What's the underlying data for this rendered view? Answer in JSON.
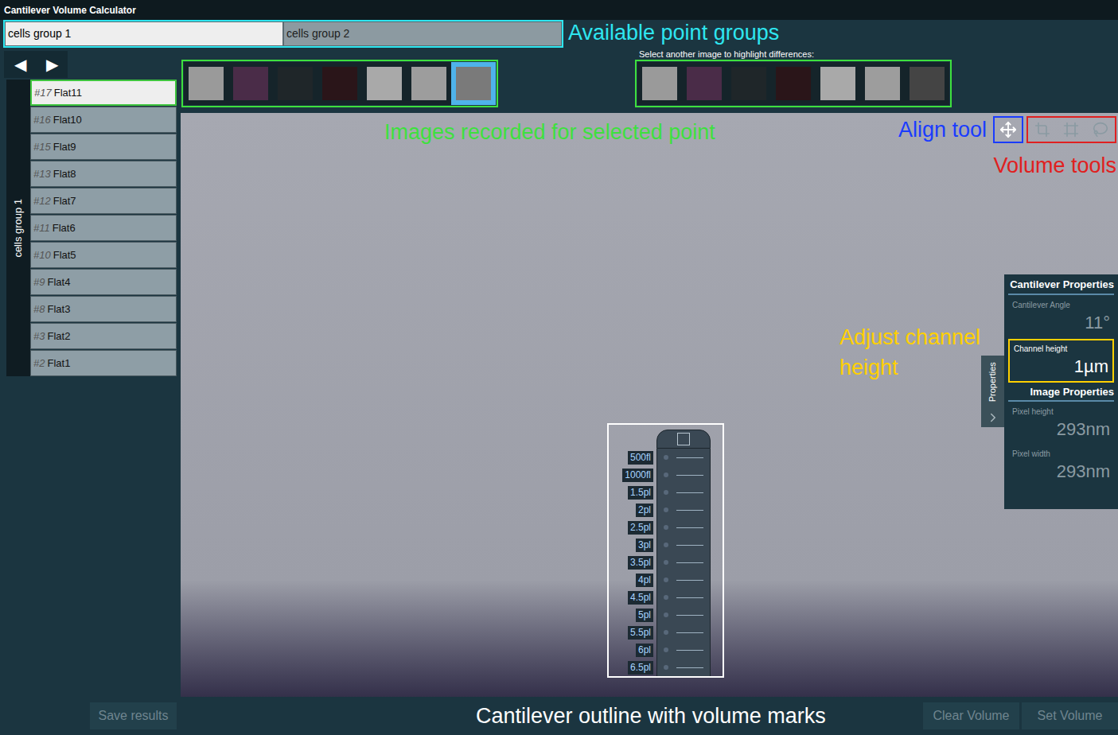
{
  "window": {
    "title": "Cantilever Volume Calculator"
  },
  "point_groups": {
    "annotation": "Available point groups",
    "tabs": [
      {
        "label": "cells group 1",
        "selected": true
      },
      {
        "label": "cells group 2",
        "selected": false
      }
    ]
  },
  "navigation": {
    "prev": "◀",
    "next": "▶"
  },
  "sidebar": {
    "group_label": "cells group 1",
    "items": [
      {
        "id": "#17",
        "name": "Flat11",
        "selected": true
      },
      {
        "id": "#16",
        "name": "Flat10",
        "selected": false
      },
      {
        "id": "#15",
        "name": "Flat9",
        "selected": false
      },
      {
        "id": "#13",
        "name": "Flat8",
        "selected": false
      },
      {
        "id": "#12",
        "name": "Flat7",
        "selected": false
      },
      {
        "id": "#11",
        "name": "Flat6",
        "selected": false
      },
      {
        "id": "#10",
        "name": "Flat5",
        "selected": false
      },
      {
        "id": "#9",
        "name": "Flat4",
        "selected": false
      },
      {
        "id": "#8",
        "name": "Flat3",
        "selected": false
      },
      {
        "id": "#3",
        "name": "Flat2",
        "selected": false
      },
      {
        "id": "#2",
        "name": "Flat1",
        "selected": false
      }
    ]
  },
  "images": {
    "annotation": "Images recorded for selected point",
    "thumbnails": [
      {
        "color": "#9a9a9a",
        "selected": false
      },
      {
        "color": "#4a2c48",
        "selected": false
      },
      {
        "color": "#1f2629",
        "selected": false
      },
      {
        "color": "#2a1519",
        "selected": false
      },
      {
        "color": "#a9a9a9",
        "selected": false
      },
      {
        "color": "#9d9d9d",
        "selected": false
      },
      {
        "color": "#7a7a7a",
        "selected": true
      }
    ]
  },
  "compare": {
    "label": "Select another image to highlight differences:",
    "thumbnails": [
      {
        "color": "#9a9a9a"
      },
      {
        "color": "#4a2c48"
      },
      {
        "color": "#1f2629"
      },
      {
        "color": "#2a1519"
      },
      {
        "color": "#a9a9a9"
      },
      {
        "color": "#9d9d9d"
      },
      {
        "color": "#444444"
      }
    ]
  },
  "tools": {
    "align": {
      "annotation": "Align tool",
      "active": true
    },
    "volume": {
      "annotation": "Volume tools",
      "active": false
    }
  },
  "properties": {
    "tab": "Properties",
    "annotation": "Adjust channel height",
    "sections": [
      {
        "title": "Cantilever Properties",
        "fields": [
          {
            "label": "Cantilever Angle",
            "value": "11°",
            "highlighted": false
          },
          {
            "label": "Channel height",
            "value": "1µm",
            "highlighted": true
          }
        ]
      },
      {
        "title": "Image Properties",
        "fields": [
          {
            "label": "Pixel height",
            "value": "293nm",
            "highlighted": false
          },
          {
            "label": "Pixel width",
            "value": "293nm",
            "highlighted": false
          }
        ]
      }
    ]
  },
  "cantilever": {
    "annotation": "Cantilever outline with volume marks",
    "marks": [
      "500fl",
      "1000fl",
      "1.5pl",
      "2pl",
      "2.5pl",
      "3pl",
      "3.5pl",
      "4pl",
      "4.5pl",
      "5pl",
      "5.5pl",
      "6pl",
      "6.5pl"
    ]
  },
  "buttons": {
    "save": {
      "label": "Save results",
      "disabled": true
    },
    "actions": [
      {
        "label": "Clear Volume",
        "disabled": true
      },
      {
        "label": "Set Volume",
        "disabled": true
      }
    ]
  }
}
